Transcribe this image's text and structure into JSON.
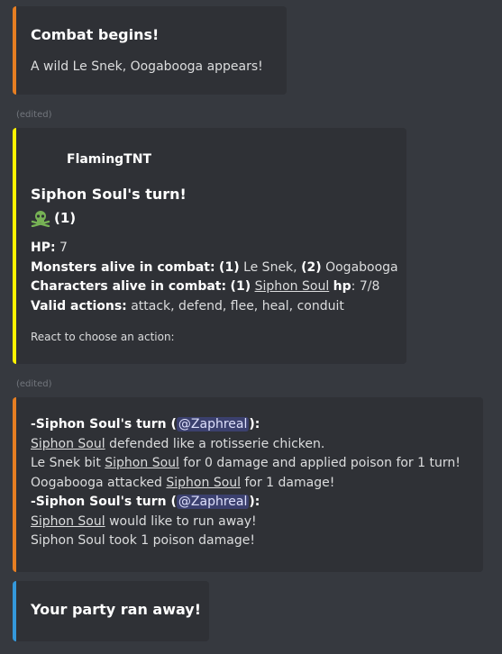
{
  "colors": {
    "background": "#36393f",
    "embed_bg": "#2f3136",
    "combat_accent": "#e67e22",
    "turn_accent": "#fff200",
    "ran_accent": "#3498db"
  },
  "embeds": [
    {
      "title": "Combat begins!",
      "description": "A wild Le Snek, Oogabooga appears!"
    },
    {
      "author": "FlamingTNT",
      "title": "Siphon Soul's turn!",
      "status_icon": "skull-crossbones-icon",
      "status_count": "(1)",
      "hp_label": "HP:",
      "hp_value": "7",
      "monsters_label": "Monsters alive in combat:",
      "monsters": [
        {
          "index": "1",
          "name": "Le Snek"
        },
        {
          "index": "2",
          "name": "Oogabooga"
        }
      ],
      "characters_label": "Characters alive in combat:",
      "characters": [
        {
          "index": "1",
          "name": "Siphon Soul",
          "hp_label": "hp",
          "hp": "7/8"
        }
      ],
      "actions_label": "Valid actions:",
      "actions": "attack, defend, flee, heal, conduit",
      "prompt": "React to choose an action:"
    },
    {
      "turn_label_1": "-Siphon Soul's turn (",
      "mention_1": "@Zaphreal",
      "turn_close_1": "):",
      "line_1_link": "Siphon Soul",
      "line_1_rest": " defended like a rotisserie chicken.",
      "line_2_pre": "Le Snek bit ",
      "line_2_link": "Siphon Soul",
      "line_2_rest": " for 0 damage and applied poison for 1 turn!",
      "line_3_pre": "Oogabooga attacked ",
      "line_3_link": "Siphon Soul",
      "line_3_rest": " for 1 damage!",
      "turn_label_2": "-Siphon Soul's turn (",
      "mention_2": "@Zaphreal",
      "turn_close_2": "):",
      "line_4_link": "Siphon Soul",
      "line_4_rest": " would like to run away!",
      "line_5": "Siphon Soul took 1 poison damage!"
    },
    {
      "title": "Your party ran away!"
    }
  ],
  "edited_label": "(edited)"
}
